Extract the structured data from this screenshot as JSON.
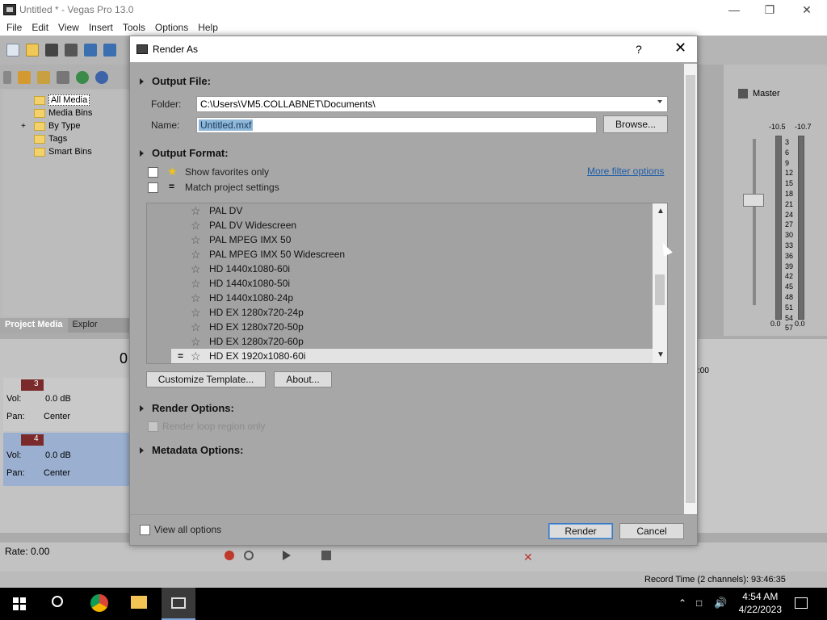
{
  "window": {
    "title": "Untitled * - Vegas Pro 13.0",
    "minimize_icon": "minimize-icon",
    "maximize_icon": "restore-icon",
    "close_icon": "close-icon"
  },
  "menu": [
    "File",
    "Edit",
    "View",
    "Insert",
    "Tools",
    "Options",
    "Help"
  ],
  "project_media": {
    "tree": [
      {
        "label": "All Media",
        "selected": true
      },
      {
        "label": "Media Bins",
        "selected": false
      },
      {
        "label": "By Type",
        "selected": false
      },
      {
        "label": "Tags",
        "selected": false
      },
      {
        "label": "Smart Bins",
        "selected": false
      }
    ],
    "tabs": [
      "Project Media",
      "Explor"
    ]
  },
  "tracks": [
    {
      "number": "3",
      "vol_label": "Vol:",
      "vol_value": "0.0 dB",
      "pan_label": "Pan:",
      "pan_value": "Center"
    },
    {
      "number": "4",
      "vol_label": "Vol:",
      "vol_value": "0.0 dB",
      "pan_label": "Pan:",
      "pan_value": "Center"
    }
  ],
  "timeline": {
    "rate": "Rate: 0.00",
    "record_time": "Record Time (2 channels): 93:46:35",
    "ruler_label": ":00",
    "counter_digit": "0"
  },
  "mixer": {
    "label": "Master",
    "left_peak": "-10.5",
    "right_peak": "-10.7",
    "scale": [
      "3",
      "6",
      "9",
      "12",
      "15",
      "18",
      "21",
      "24",
      "27",
      "30",
      "33",
      "36",
      "39",
      "42",
      "45",
      "48",
      "51",
      "54",
      "57"
    ],
    "left_zero": "0.0",
    "right_zero": "0.0"
  },
  "dialog": {
    "title": "Render As",
    "help": "?",
    "output_file_header": "Output File:",
    "folder_label": "Folder:",
    "folder_value": "C:\\Users\\VM5.COLLABNET\\Documents\\",
    "name_label": "Name:",
    "name_value": "Untitled.mxf",
    "browse_label": "Browse...",
    "output_format_header": "Output Format:",
    "show_favorites_label": "Show favorites only",
    "match_project_label": "Match project settings",
    "more_filter_link": "More filter options",
    "templates": [
      {
        "name": "PAL DV",
        "selected": false,
        "match": false
      },
      {
        "name": "PAL DV Widescreen",
        "selected": false,
        "match": false
      },
      {
        "name": "PAL MPEG IMX 50",
        "selected": false,
        "match": false
      },
      {
        "name": "PAL MPEG IMX 50 Widescreen",
        "selected": false,
        "match": false
      },
      {
        "name": "HD 1440x1080-60i",
        "selected": false,
        "match": false
      },
      {
        "name": "HD 1440x1080-50i",
        "selected": false,
        "match": false
      },
      {
        "name": "HD 1440x1080-24p",
        "selected": false,
        "match": false
      },
      {
        "name": "HD EX 1280x720-24p",
        "selected": false,
        "match": false
      },
      {
        "name": "HD EX 1280x720-50p",
        "selected": false,
        "match": false
      },
      {
        "name": "HD EX 1280x720-60p",
        "selected": false,
        "match": false
      },
      {
        "name": "HD EX 1920x1080-60i",
        "selected": true,
        "match": true
      }
    ],
    "customize_label": "Customize Template...",
    "about_label": "About...",
    "render_options_header": "Render Options:",
    "render_loop_label": "Render loop region only",
    "metadata_options_header": "Metadata Options:",
    "view_all_label": "View all options",
    "render_label": "Render",
    "cancel_label": "Cancel"
  },
  "taskbar": {
    "time": "4:54 AM",
    "date": "4/22/2023"
  }
}
